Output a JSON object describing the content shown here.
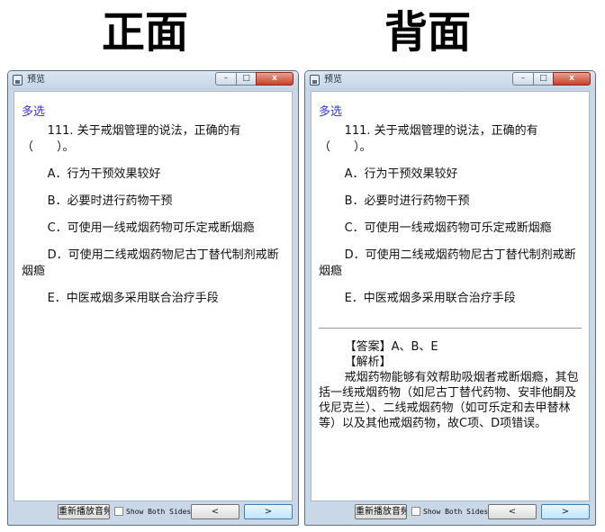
{
  "headings": {
    "front": "正面",
    "back": "背面"
  },
  "window": {
    "title": "预览",
    "controls": {
      "minimize": "–",
      "maximize": "□",
      "close": "x"
    }
  },
  "question": {
    "type": "多选",
    "stem": "111. 关于戒烟管理的说法，正确的有（　　）。",
    "options": [
      "A．行为干预效果较好",
      "B．必要时进行药物干预",
      "C．可使用一线戒烟药物可乐定戒断烟瘾",
      "D．可使用二线戒烟药物尼古丁替代制剂戒断烟瘾",
      "E．中医戒烟多采用联合治疗手段"
    ]
  },
  "answer": {
    "answer_line": "【答案】A、B、E",
    "analysis_label": "【解析】",
    "analysis_text": "戒烟药物能够有效帮助吸烟者戒断烟瘾，其包括一线戒烟药物（如尼古丁替代药物、安非他酮及伐尼克兰）、二线戒烟药物（如可乐定和去甲替林等）以及其他戒烟药物，故C项、D项错误。"
  },
  "bottom": {
    "replay_label": "重新播放音频",
    "show_both_label": "Show Both Sides",
    "show_both_checked": false,
    "prev_label": "<",
    "next_label": ">"
  }
}
